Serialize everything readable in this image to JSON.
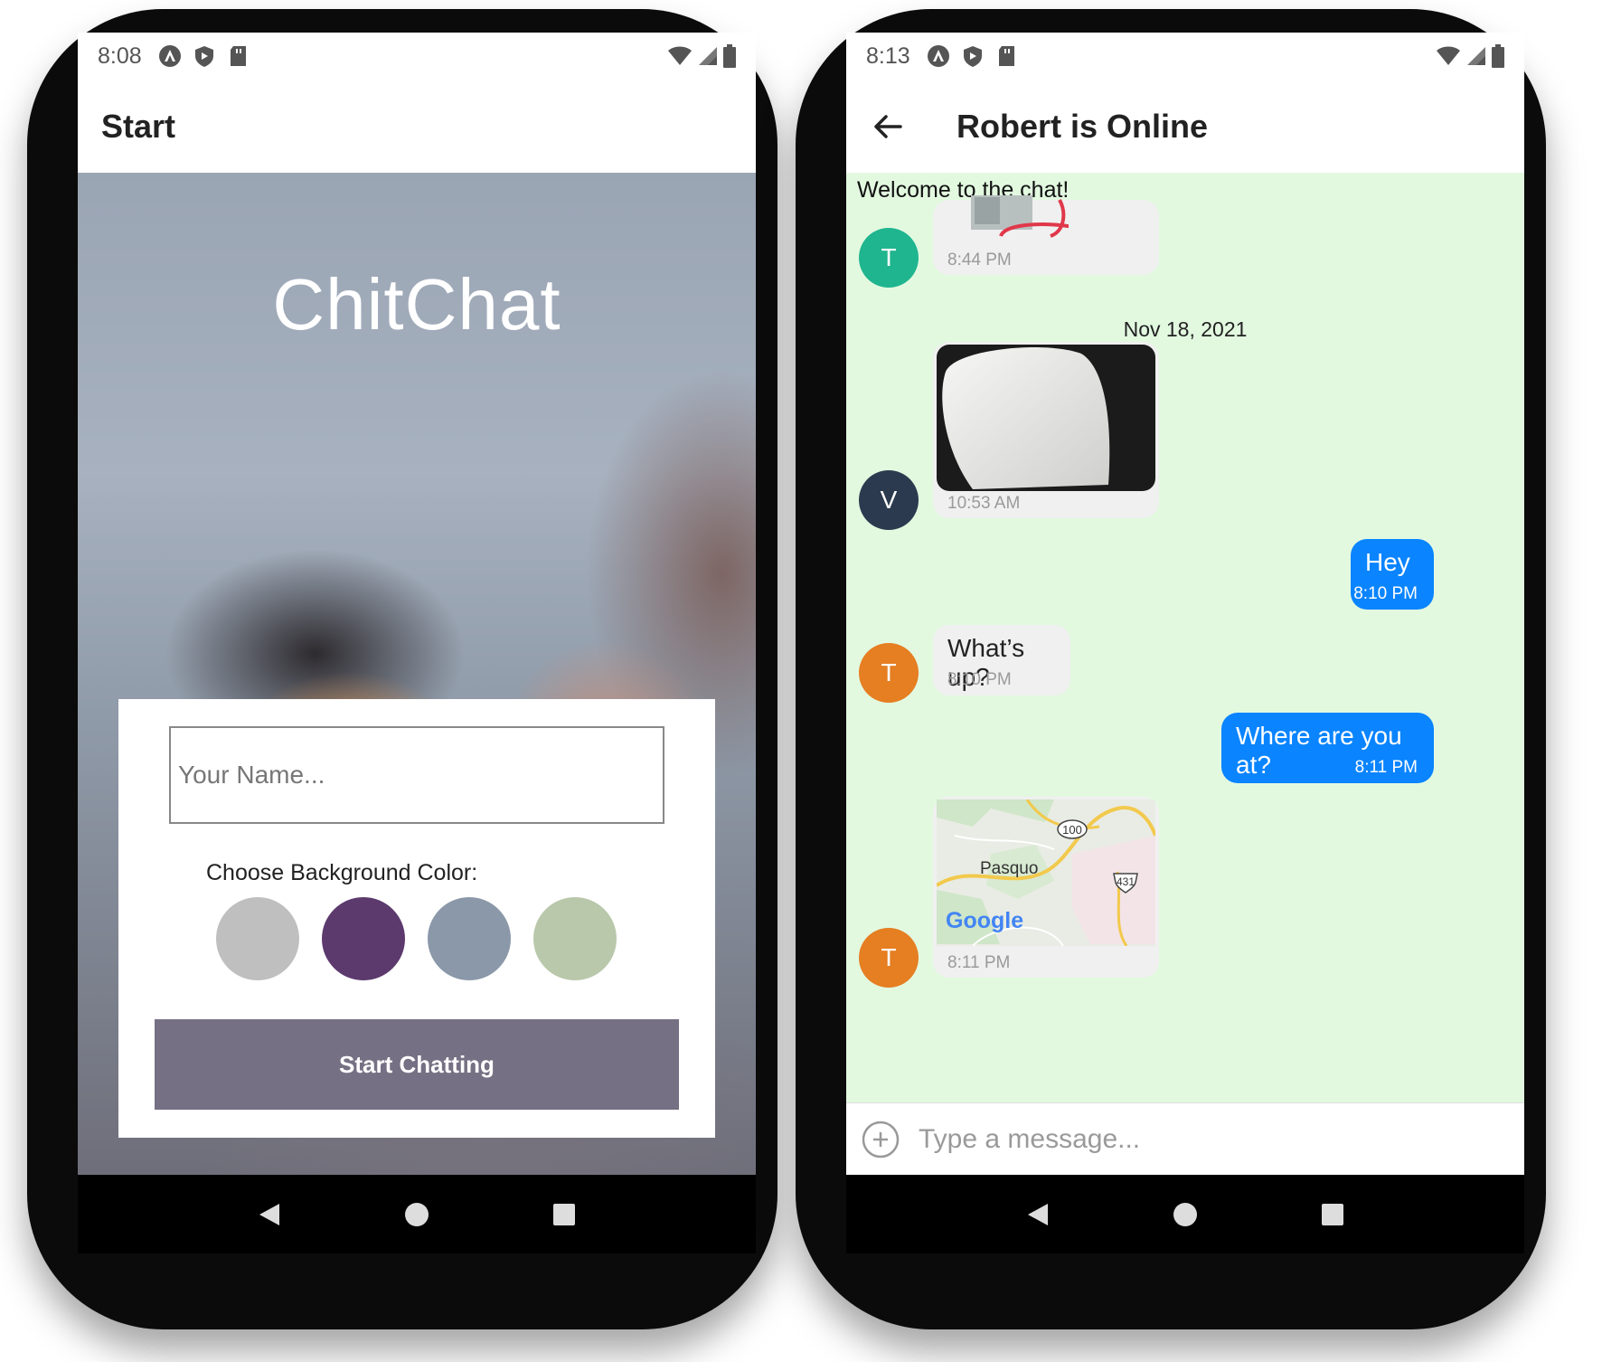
{
  "left_screen": {
    "status": {
      "time": "8:08"
    },
    "appbar_title": "Start",
    "app_title": "ChitChat",
    "name_placeholder": "Your Name...",
    "color_label": "Choose Background Color:",
    "color_options": [
      "#bfbfbf",
      "#5c3a6d",
      "#8a98a9",
      "#b9c8ab"
    ],
    "start_button": "Start Chatting",
    "start_button_color": "#757083"
  },
  "right_screen": {
    "status": {
      "time": "8:13"
    },
    "appbar_title": "Robert is Online",
    "welcome": "Welcome to the chat!",
    "day_separator": "Nov 18, 2021",
    "background_color": "#e2f9e0",
    "messages": [
      {
        "avatar": "T",
        "avatar_color": "#1fb58f",
        "type": "image",
        "time": "8:44 PM"
      },
      {
        "avatar": "V",
        "avatar_color": "#2b3a4e",
        "type": "image",
        "time": "10:53 AM"
      },
      {
        "outgoing": true,
        "text": "Hey",
        "time": "8:10 PM"
      },
      {
        "avatar": "T",
        "avatar_color": "#e67e22",
        "text": "What’s up?",
        "time": "8:10 PM"
      },
      {
        "outgoing": true,
        "text": "Where are you at?",
        "time": "8:11 PM"
      },
      {
        "avatar": "T",
        "avatar_color": "#e67e22",
        "type": "map",
        "time": "8:11 PM",
        "map_labels": {
          "place": "Pasquo",
          "route_a": "100",
          "route_b": "431",
          "brand": "Google"
        }
      }
    ],
    "input_placeholder": "Type a message..."
  }
}
